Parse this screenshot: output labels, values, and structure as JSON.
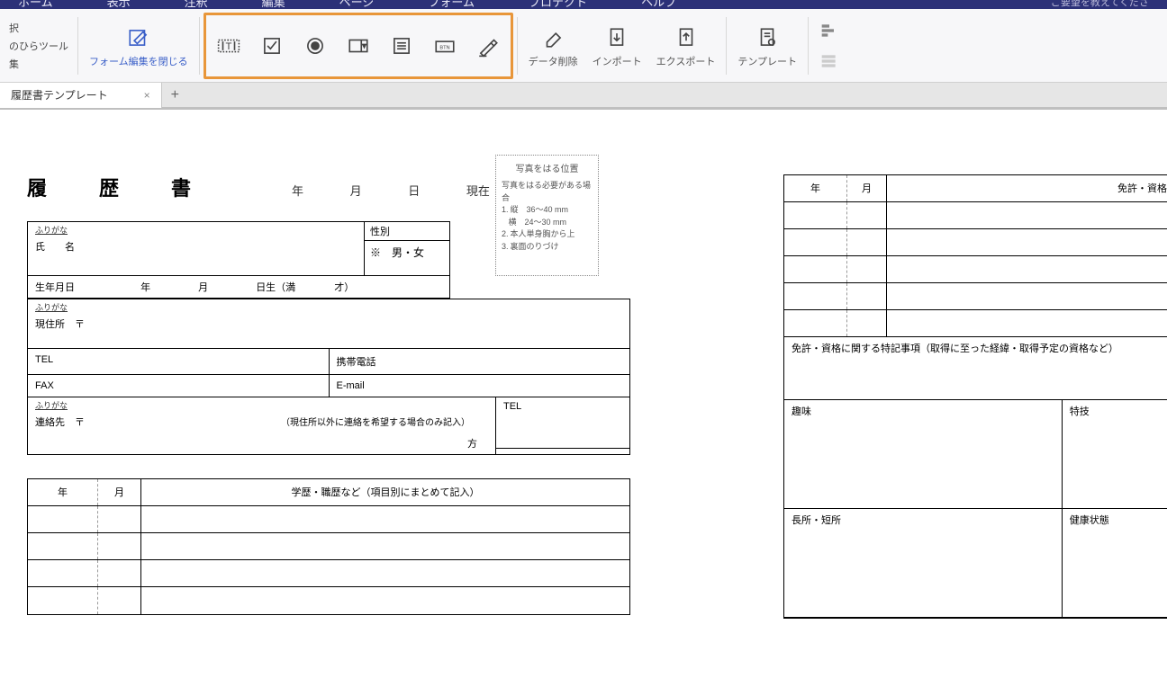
{
  "menubar": {
    "items": [
      "ホーム",
      "表示",
      "注釈",
      "編集",
      "ページ",
      "フォーム",
      "プロテクト",
      "ヘルプ"
    ],
    "search_hint": "ご要望を教えてくださ"
  },
  "ribbon": {
    "left_trunc": [
      "択",
      "のひらツール",
      "集"
    ],
    "close_form_edit": "フォーム編集を閉じる",
    "data_delete": "データ削除",
    "import": "インポート",
    "export": "エクスポート",
    "template": "テンプレート"
  },
  "tab": {
    "title": "履歴書テンプレート"
  },
  "doc": {
    "title": "履　歴　書",
    "date": {
      "year": "年",
      "month": "月",
      "day": "日",
      "current": "現在"
    },
    "photo": {
      "title": "写真をはる位置",
      "note": "写真をはる必要がある場合",
      "l1": "縦　36～40 mm",
      "l2": "横　24～30 mm",
      "l3": "本人単身胸から上",
      "l4": "裏面のりづけ"
    },
    "furigana": "ふりがな",
    "name_label": "氏　　名",
    "gender_label": "性別",
    "gender_value": "※　男・女",
    "birth": {
      "label": "生年月日",
      "y": "年",
      "m": "月",
      "d": "日生（満",
      "age": "才）"
    },
    "addr_label": "現住所　〒",
    "tel": "TEL",
    "mobile": "携帯電話",
    "fax": "FAX",
    "email": "E-mail",
    "contact_label": "連絡先　〒",
    "contact_note": "（現住所以外に連絡を希望する場合のみ記入）",
    "contact_suffix": "方",
    "history_header": {
      "y": "年",
      "m": "月",
      "d": "学歴・職歴など（項目別にまとめて記入）"
    },
    "license_header": {
      "y": "年",
      "m": "月",
      "d": "免許・資格"
    },
    "license_note": "免許・資格に関する特記事項（取得に至った経緯・取得予定の資格など）",
    "hobby": "趣味",
    "skill": "特技",
    "strength": "長所・短所",
    "health": "健康状態"
  }
}
